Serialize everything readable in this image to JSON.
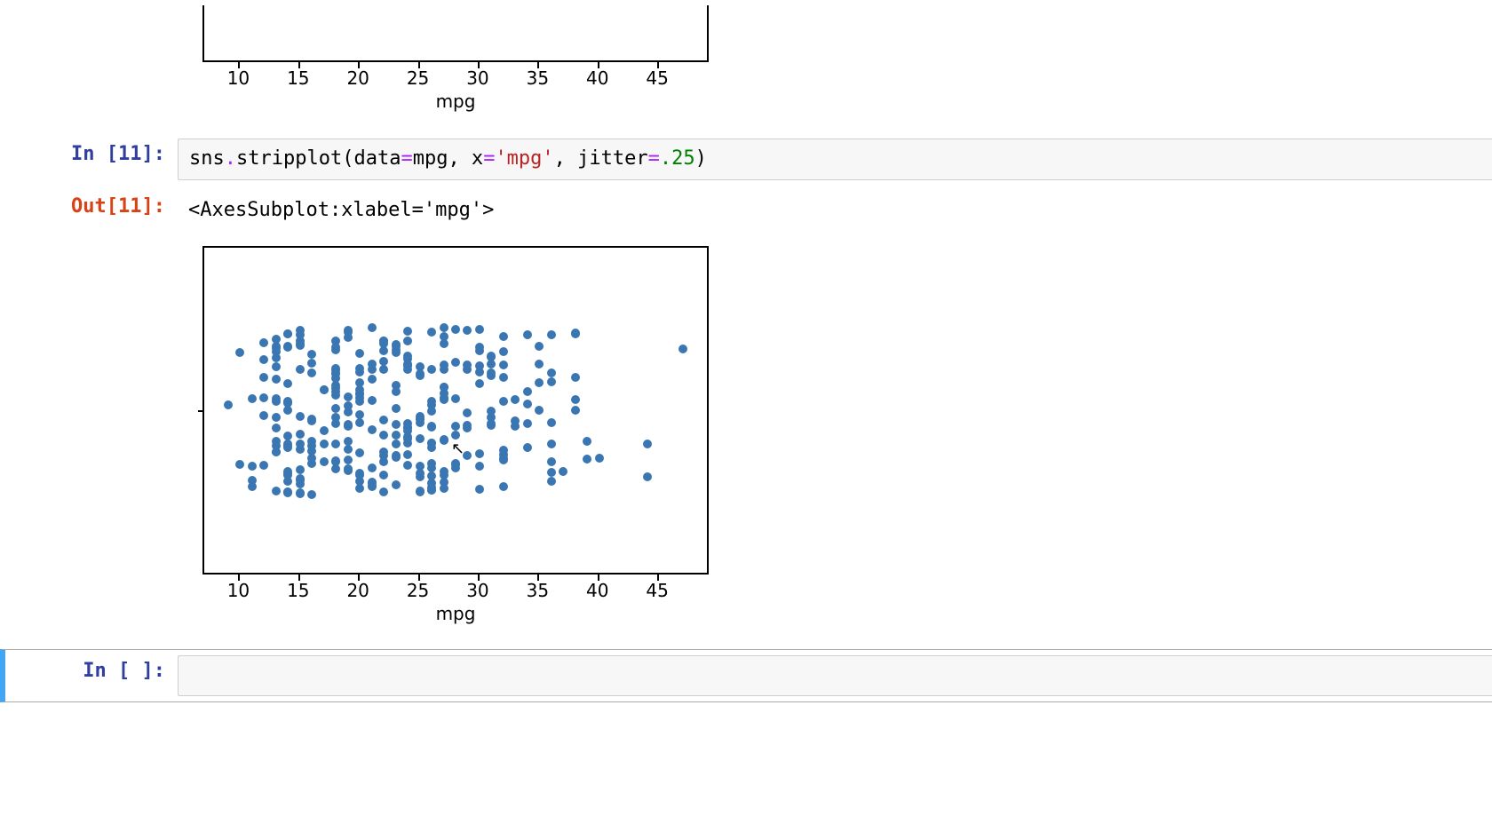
{
  "prompts": {
    "in11": "In [11]:",
    "out11": "Out[11]:",
    "in_empty": "In [ ]:"
  },
  "code11": {
    "frag0": "sns",
    "frag1": ".",
    "frag2": "stripplot",
    "frag3": "(data",
    "frag4": "=",
    "frag5": "mpg, x",
    "frag6": "=",
    "frag7": "'mpg'",
    "frag8": ", jitter",
    "frag9": "=",
    "frag10": ".25",
    "frag11": ")"
  },
  "out11_text": "<AxesSubplot:xlabel='mpg'>",
  "chart_data": [
    {
      "type": "scatter-jitter",
      "xlabel": "mpg",
      "xlim": [
        7,
        49
      ],
      "xticks": [
        10,
        15,
        20,
        25,
        30,
        35,
        40,
        45
      ],
      "x": [
        18,
        15,
        18,
        16,
        17,
        15,
        14,
        14,
        14,
        15,
        15,
        14,
        15,
        14,
        24,
        22,
        18,
        21,
        27,
        26,
        25,
        24,
        25,
        26,
        21,
        10,
        10,
        11,
        9,
        27,
        28,
        25,
        25,
        19,
        16,
        17,
        19,
        18,
        14,
        14,
        14,
        14,
        12,
        13,
        13,
        18,
        22,
        19,
        18,
        23,
        28,
        30,
        30,
        31,
        35,
        27,
        26,
        24,
        25,
        23,
        20,
        21,
        13,
        14,
        15,
        14,
        17,
        11,
        13,
        12,
        13,
        19,
        15,
        13,
        13,
        14,
        18,
        22,
        21,
        26,
        22,
        28,
        23,
        28,
        27,
        13,
        14,
        13,
        14,
        15,
        12,
        13,
        13,
        14,
        13,
        12,
        13,
        18,
        16,
        18,
        18,
        23,
        26,
        11,
        12,
        13,
        12,
        18,
        20,
        21,
        22,
        18,
        19,
        21,
        26,
        15,
        16,
        29,
        24,
        20,
        19,
        15,
        24,
        20,
        11,
        20,
        21,
        19,
        15,
        31,
        26,
        32,
        25,
        16,
        16,
        18,
        16,
        13,
        14,
        14,
        14,
        29,
        26,
        26,
        31,
        32,
        28,
        24,
        26,
        24,
        26,
        31,
        19,
        18,
        15,
        15,
        16,
        15,
        16,
        14,
        17,
        16,
        15,
        18,
        21,
        20,
        13,
        29,
        23,
        20,
        23,
        24,
        25,
        24,
        18,
        29,
        19,
        23,
        23,
        22,
        25,
        33,
        28,
        25,
        25,
        26,
        27,
        17,
        16,
        15,
        14,
        22,
        24,
        22,
        19,
        18,
        30,
        27,
        27,
        30,
        21,
        23,
        23,
        24,
        25,
        24,
        20,
        18,
        19,
        20,
        20,
        19,
        20,
        22,
        20,
        19,
        20,
        20,
        31,
        29,
        36,
        27,
        27,
        34,
        30,
        31,
        34,
        26,
        27,
        24,
        23,
        38,
        36,
        26,
        22,
        32,
        28,
        30,
        23,
        35,
        24,
        39,
        36,
        20,
        19,
        18,
        27,
        21,
        24,
        34,
        44,
        32,
        30,
        26,
        40,
        30,
        35,
        33,
        25,
        23,
        27,
        47,
        32,
        39,
        35,
        32,
        24,
        26,
        22,
        20,
        33,
        30,
        22,
        21,
        29,
        32,
        28,
        27,
        34,
        31,
        29,
        27,
        24,
        36,
        37,
        31,
        38,
        36,
        36,
        36,
        34,
        38,
        32,
        38,
        25,
        38,
        26,
        22,
        32,
        36,
        27,
        27,
        44,
        32,
        28,
        31
      ],
      "jitter": 0.25,
      "note": "x values are mpg values (approx) from seaborn mpg dataset; y positions are uniform jitter in [-0.25,0.25]"
    },
    {
      "type": "scatter-jitter",
      "xlabel": "mpg",
      "xlim": [
        7,
        49
      ],
      "xticks": [
        10,
        15,
        20,
        25,
        30,
        35,
        40,
        45
      ],
      "x": [],
      "note": "partially visible upper plot — only bottom frame and x-axis shown"
    }
  ]
}
